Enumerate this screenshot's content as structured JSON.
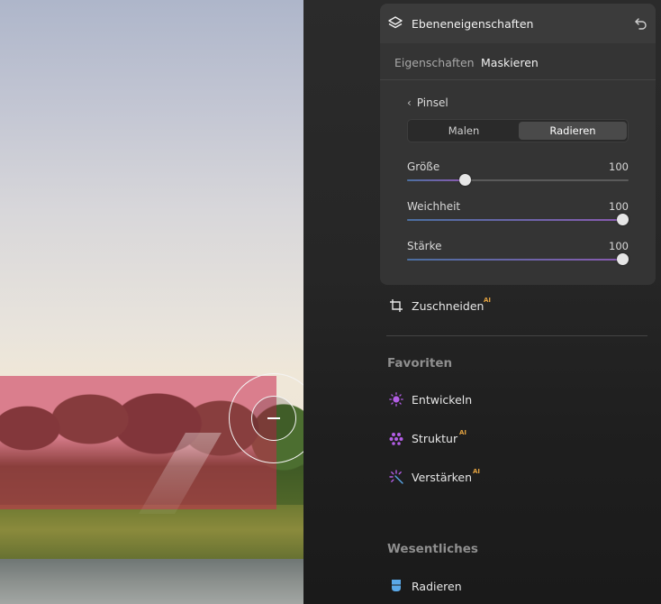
{
  "canvas": {
    "brush_mode": "erase"
  },
  "panel": {
    "header": {
      "title": "Ebeneneigenschaften",
      "icon": "layers-icon",
      "undo_icon": "undo-icon"
    },
    "tabs": [
      {
        "label": "Eigenschaften",
        "active": false
      },
      {
        "label": "Maskieren",
        "active": true
      }
    ],
    "brush": {
      "back_label": "Pinsel",
      "modes": [
        {
          "label": "Malen",
          "active": false
        },
        {
          "label": "Radieren",
          "active": true
        }
      ],
      "sliders": [
        {
          "label": "Größe",
          "value": "100",
          "position": 0.25
        },
        {
          "label": "Weichheit",
          "value": "100",
          "position": 1.0
        },
        {
          "label": "Stärke",
          "value": "100",
          "position": 1.0
        }
      ]
    },
    "crop": {
      "label": "Zuschneiden",
      "badge": "AI",
      "icon": "crop-icon"
    },
    "favorites": {
      "title": "Favoriten",
      "items": [
        {
          "label": "Entwickeln",
          "icon": "sun-icon",
          "badge": ""
        },
        {
          "label": "Struktur",
          "icon": "dots-icon",
          "badge": "AI"
        },
        {
          "label": "Verstärken",
          "icon": "sparkle-icon",
          "badge": "AI"
        }
      ]
    },
    "essentials": {
      "title": "Wesentliches",
      "items": [
        {
          "label": "Radieren",
          "icon": "eraser-icon",
          "badge": ""
        }
      ]
    },
    "colors": {
      "accent_purple": "#b35ee6",
      "accent_blue": "#5aa8e8",
      "ai_badge": "#e0a040",
      "mask_overlay": "#c82850"
    }
  }
}
